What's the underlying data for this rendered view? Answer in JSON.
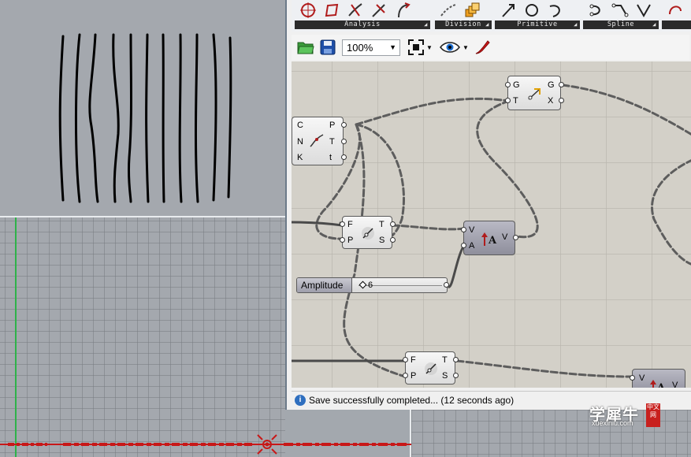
{
  "ribbon": {
    "groups": [
      {
        "label": "Analysis"
      },
      {
        "label": "Division"
      },
      {
        "label": "Primitive"
      },
      {
        "label": "Spline"
      },
      {
        "label": "U"
      }
    ]
  },
  "toolbar": {
    "zoom_value": "100%"
  },
  "canvas": {
    "components": {
      "curve_eval": {
        "inputs": [
          "C",
          "N",
          "K"
        ],
        "outputs": [
          "P",
          "T",
          "t"
        ]
      },
      "closest_top": {
        "inputs": [
          "G",
          "T"
        ],
        "outputs": [
          "G",
          "X"
        ]
      },
      "param_1": {
        "inputs": [
          "F",
          "P"
        ],
        "outputs": [
          "T",
          "S"
        ]
      },
      "amplitude_1": {
        "inputs": [
          "V",
          "A"
        ],
        "outputs": [
          "V"
        ]
      },
      "param_2": {
        "inputs": [
          "F",
          "P"
        ],
        "outputs": [
          "T",
          "S"
        ]
      },
      "amplitude_2": {
        "inputs": [
          "V"
        ],
        "outputs": [
          "V"
        ]
      }
    },
    "slider": {
      "label": "Amplitude",
      "value": "6"
    }
  },
  "status": {
    "message": "Save successfully completed... (12 seconds ago)"
  },
  "watermark": {
    "brand": "学犀牛",
    "url": "xuexiniu.com",
    "seal": "中文网"
  },
  "colors": {
    "viewport_bg": "#a4a8ae",
    "canvas_bg": "#d3d0c8",
    "axis_green": "#2fb24a",
    "axis_red": "#c81818",
    "status_icon": "#2f6fbf"
  }
}
